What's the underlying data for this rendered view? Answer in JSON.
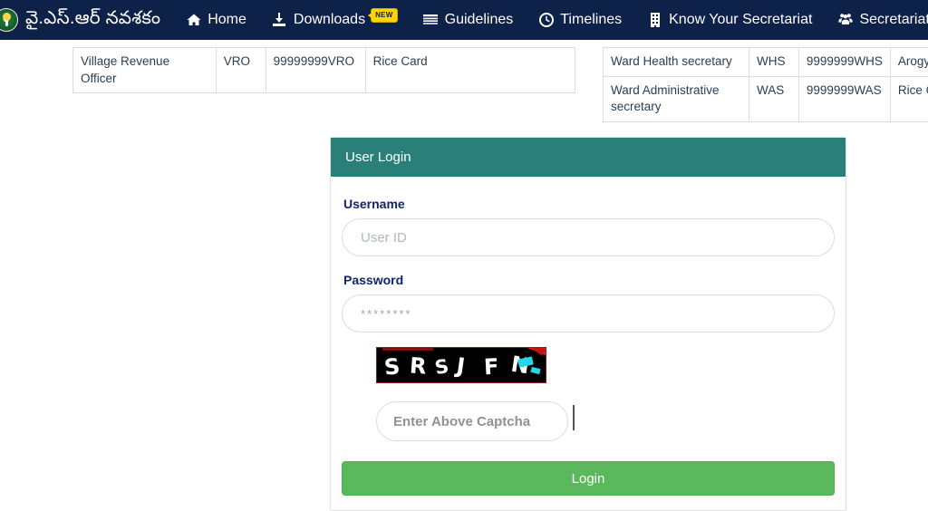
{
  "navbar": {
    "brand": {
      "text": "వై.ఎస్.ఆర్ నవశకం",
      "logo_icon": "ysr-emblem-icon"
    },
    "background_color": "#0d2149",
    "items": [
      {
        "label": "Home",
        "icon": "home-icon",
        "badge": ""
      },
      {
        "label": "Downloads",
        "icon": "download-icon",
        "badge": "NEW"
      },
      {
        "label": "Guidelines",
        "icon": "list-lines-icon",
        "badge": ""
      },
      {
        "label": "Timelines",
        "icon": "clock-icon",
        "badge": ""
      },
      {
        "label": "Know Your Secretariat",
        "icon": "building-icon",
        "badge": ""
      },
      {
        "label": "Secretariat Staff M",
        "icon": "users-group-icon",
        "badge": ""
      }
    ]
  },
  "tables": {
    "left": {
      "rows": [
        [
          "Village Revenue Officer",
          "VRO",
          "99999999VRO",
          "Rice Card"
        ]
      ]
    },
    "right": {
      "rows": [
        [
          "Ward Health secretary",
          "WHS",
          "9999999WHS",
          "Arogy"
        ],
        [
          "Ward Administrative secretary",
          "WAS",
          "9999999WAS",
          "Rice C"
        ]
      ]
    }
  },
  "login_card": {
    "header_title": "User Login",
    "header_color": "#2a8078",
    "username": {
      "label": "Username",
      "placeholder": "User ID",
      "value": ""
    },
    "password": {
      "label": "Password",
      "placeholder": "********",
      "value": ""
    },
    "captcha": {
      "image_text": "SRSJFN",
      "chars": [
        "S",
        "R",
        "S",
        "J",
        "F",
        "N"
      ],
      "input_placeholder": "Enter Above Captcha",
      "input_value": "",
      "background_color": "#000000",
      "border_color": "#8b1f1f",
      "noise_colors": [
        "#e01b1b",
        "#25d8e8"
      ]
    },
    "submit": {
      "label": "Login",
      "color": "#5cb85c"
    }
  }
}
